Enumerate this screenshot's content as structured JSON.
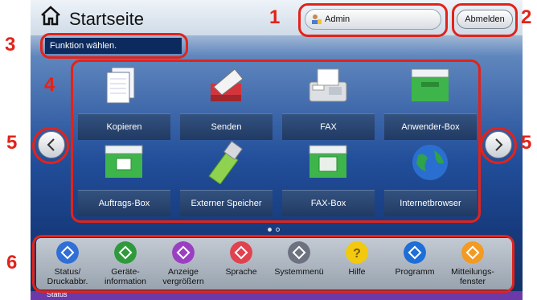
{
  "header": {
    "title": "Startseite",
    "admin_label": "Admin",
    "logout_label": "Abmelden"
  },
  "message": "Funktion wählen.",
  "tiles": [
    {
      "label": "Kopieren",
      "icon": "copy-icon"
    },
    {
      "label": "Senden",
      "icon": "send-icon"
    },
    {
      "label": "FAX",
      "icon": "fax-icon"
    },
    {
      "label": "Anwender-Box",
      "icon": "user-box-icon"
    },
    {
      "label": "Auftrags-Box",
      "icon": "job-box-icon"
    },
    {
      "label": "Externer Speicher",
      "icon": "usb-icon"
    },
    {
      "label": "FAX-Box",
      "icon": "fax-box-icon"
    },
    {
      "label": "Internetbrowser",
      "icon": "globe-icon"
    }
  ],
  "dock": [
    {
      "label": "Status/\nDruckabbr.",
      "color": "#2f6fd6",
      "icon": "status-icon"
    },
    {
      "label": "Geräte-\ninformation",
      "color": "#2f9a3c",
      "icon": "device-info-icon"
    },
    {
      "label": "Anzeige\nvergrößern",
      "color": "#9b3fc2",
      "icon": "accessibility-icon"
    },
    {
      "label": "Sprache",
      "color": "#e0424f",
      "icon": "language-icon"
    },
    {
      "label": "Systemmenü",
      "color": "#6c7280",
      "icon": "system-menu-icon"
    },
    {
      "label": "Hilfe",
      "color": "#f2c90f",
      "icon": "help-icon"
    },
    {
      "label": "Programm",
      "color": "#1e6ed8",
      "icon": "program-icon"
    },
    {
      "label": "Mitteilungs-\nfenster",
      "color": "#f39a22",
      "icon": "message-window-icon"
    }
  ],
  "callouts": [
    "1",
    "2",
    "3",
    "4",
    "5",
    "5",
    "6"
  ],
  "bottom": {
    "status_label": "Status"
  },
  "colors": {
    "callout": "#e2231a"
  }
}
